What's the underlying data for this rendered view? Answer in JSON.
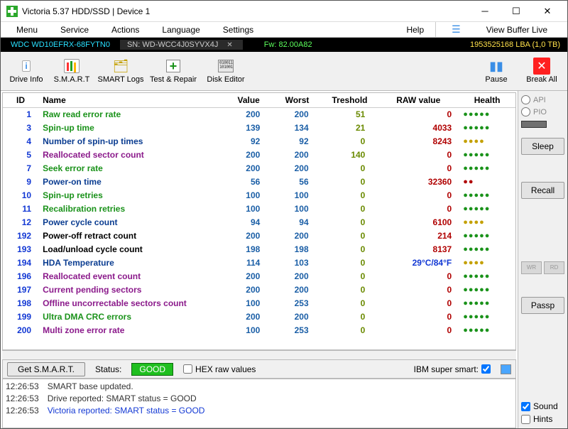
{
  "window": {
    "title": "Victoria 5.37 HDD/SSD | Device 1"
  },
  "menu": {
    "items": [
      "Menu",
      "Service",
      "Actions",
      "Language",
      "Settings"
    ],
    "help": "Help",
    "viewbuffer": "View Buffer Live"
  },
  "device": {
    "model": "WDC WD10EFRX-68FYTN0",
    "sn_label": "SN: WD-WCC4J0SYVX4J",
    "fw": "Fw: 82.00A82",
    "lba": "1953525168 LBA (1,0 TB)"
  },
  "toolbar": {
    "driveinfo": "Drive Info",
    "smart": "S.M.A.R.T",
    "smartlogs": "SMART Logs",
    "testrepair": "Test & Repair",
    "diskeditor": "Disk Editor",
    "pause": "Pause",
    "breakall": "Break All"
  },
  "columns": {
    "id": "ID",
    "name": "Name",
    "value": "Value",
    "worst": "Worst",
    "treshold": "Treshold",
    "raw": "RAW value",
    "health": "Health"
  },
  "attrs": [
    {
      "id": "1",
      "name": "Raw read error rate",
      "cls": "green",
      "val": "200",
      "worst": "200",
      "thr": "51",
      "raw": "0",
      "hp": "g5"
    },
    {
      "id": "3",
      "name": "Spin-up time",
      "cls": "green",
      "val": "139",
      "worst": "134",
      "thr": "21",
      "raw": "4033",
      "hp": "g5"
    },
    {
      "id": "4",
      "name": "Number of spin-up times",
      "cls": "navy",
      "val": "92",
      "worst": "92",
      "thr": "0",
      "raw": "8243",
      "hp": "y4"
    },
    {
      "id": "5",
      "name": "Reallocated sector count",
      "cls": "purple",
      "val": "200",
      "worst": "200",
      "thr": "140",
      "raw": "0",
      "hp": "g5"
    },
    {
      "id": "7",
      "name": "Seek error rate",
      "cls": "green",
      "val": "200",
      "worst": "200",
      "thr": "0",
      "raw": "0",
      "hp": "g5"
    },
    {
      "id": "9",
      "name": "Power-on time",
      "cls": "navy",
      "val": "56",
      "worst": "56",
      "thr": "0",
      "raw": "32360",
      "hp": "r2"
    },
    {
      "id": "10",
      "name": "Spin-up retries",
      "cls": "green",
      "val": "100",
      "worst": "100",
      "thr": "0",
      "raw": "0",
      "hp": "g5"
    },
    {
      "id": "11",
      "name": "Recalibration retries",
      "cls": "green",
      "val": "100",
      "worst": "100",
      "thr": "0",
      "raw": "0",
      "hp": "g5"
    },
    {
      "id": "12",
      "name": "Power cycle count",
      "cls": "navy",
      "val": "94",
      "worst": "94",
      "thr": "0",
      "raw": "6100",
      "hp": "y4"
    },
    {
      "id": "192",
      "name": "Power-off retract count",
      "cls": "black",
      "val": "200",
      "worst": "200",
      "thr": "0",
      "raw": "214",
      "hp": "g5"
    },
    {
      "id": "193",
      "name": "Load/unload cycle count",
      "cls": "black",
      "val": "198",
      "worst": "198",
      "thr": "0",
      "raw": "8137",
      "hp": "g5"
    },
    {
      "id": "194",
      "name": "HDA Temperature",
      "cls": "navy",
      "val": "114",
      "worst": "103",
      "thr": "0",
      "raw": "29°C/84°F",
      "temp": true,
      "hp": "y4"
    },
    {
      "id": "196",
      "name": "Reallocated event count",
      "cls": "purple",
      "val": "200",
      "worst": "200",
      "thr": "0",
      "raw": "0",
      "hp": "g5"
    },
    {
      "id": "197",
      "name": "Current pending sectors",
      "cls": "purple",
      "val": "200",
      "worst": "200",
      "thr": "0",
      "raw": "0",
      "hp": "g5"
    },
    {
      "id": "198",
      "name": "Offline uncorrectable sectors count",
      "cls": "purple",
      "val": "100",
      "worst": "253",
      "thr": "0",
      "raw": "0",
      "hp": "g5"
    },
    {
      "id": "199",
      "name": "Ultra DMA CRC errors",
      "cls": "green",
      "val": "200",
      "worst": "200",
      "thr": "0",
      "raw": "0",
      "hp": "g5"
    },
    {
      "id": "200",
      "name": "Multi zone error rate",
      "cls": "purple",
      "val": "100",
      "worst": "253",
      "thr": "0",
      "raw": "0",
      "hp": "g5"
    }
  ],
  "status": {
    "get": "Get S.M.A.R.T.",
    "label": "Status:",
    "good": "GOOD",
    "hex": "HEX raw values",
    "ibm": "IBM super smart:"
  },
  "log": [
    {
      "t": "12:26:53",
      "m": "SMART base updated.",
      "c": ""
    },
    {
      "t": "12:26:53",
      "m": "Drive reported: SMART status = GOOD",
      "c": ""
    },
    {
      "t": "12:26:53",
      "m": "Victoria reported: SMART status = GOOD",
      "c": "blue"
    }
  ],
  "rpanel": {
    "api": "API",
    "pio": "PIO",
    "sleep": "Sleep",
    "recall": "Recall",
    "wr": "WR",
    "rd": "RD",
    "passp": "Passp",
    "sound": "Sound",
    "hints": "Hints"
  }
}
